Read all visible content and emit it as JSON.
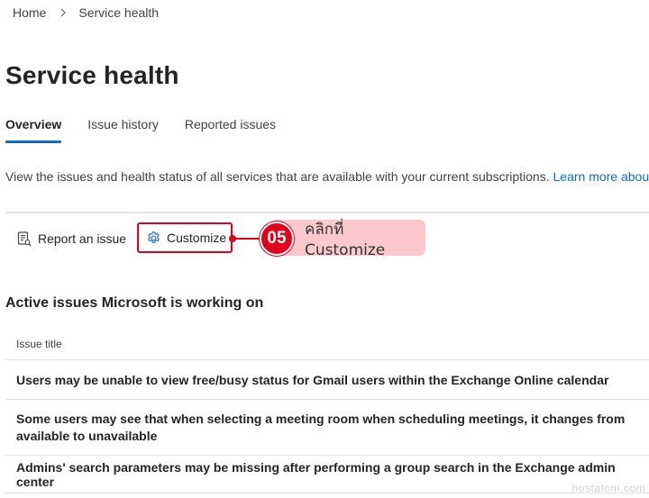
{
  "breadcrumb": {
    "home": "Home",
    "current": "Service health"
  },
  "page": {
    "title": "Service health",
    "description": "View the issues and health status of all services that are available with your current subscriptions. ",
    "learn_more": "Learn more about"
  },
  "tabs": [
    {
      "label": "Overview",
      "active": true
    },
    {
      "label": "Issue history",
      "active": false
    },
    {
      "label": "Reported issues",
      "active": false
    }
  ],
  "commands": {
    "report_issue": "Report an issue",
    "customize": "Customize"
  },
  "annotation": {
    "step": "05",
    "text": "คลิกที่ Customize",
    "color": "#e0001b",
    "background": "#fbc9cc"
  },
  "active_issues": {
    "heading": "Active issues Microsoft is working on",
    "column_header": "Issue title",
    "rows": [
      {
        "title": "Users may be unable to view free/busy status for Gmail users within the Exchange Online calendar"
      },
      {
        "title": "Some users may see that when selecting a meeting room when scheduling meetings, it changes from available to unavailable"
      },
      {
        "title": "Admins' search parameters may be missing after performing a group search in the Exchange admin center"
      }
    ]
  },
  "watermark": "hostatom.com",
  "colors": {
    "accent": "#0f6cbd",
    "highlight": "#e0001b"
  },
  "icons": {
    "breadcrumb_separator": "chevron-right-icon",
    "report": "report-document-icon",
    "customize": "gear-icon"
  }
}
